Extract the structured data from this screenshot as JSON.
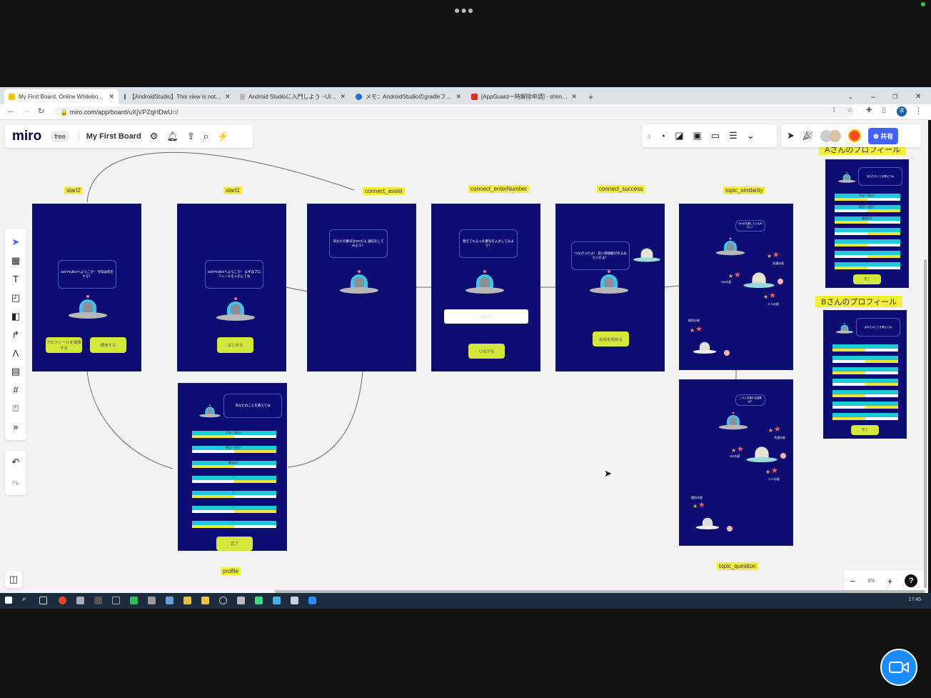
{
  "browser": {
    "tabs": [
      {
        "title": "My First Board, Online Whitebo…",
        "color": "#f5c400"
      },
      {
        "title": "【AndroidStudio】This view is not…",
        "color": "#555"
      },
      {
        "title": "Android Studioに入門しよう ~UI…",
        "color": "#888"
      },
      {
        "title": "メモ：AndroidStudioのgradleフ…",
        "color": "#1e6fd9"
      },
      {
        "title": "[AppGuard一時解除申請] - shim…",
        "color": "#d93025"
      }
    ],
    "new_tab": "+",
    "url": "miro.com/app/board/uXjVPZqHDwU=/",
    "profile_initial": "求"
  },
  "miro": {
    "logo": "miro",
    "plan": "free",
    "board_name": "My First Board",
    "share_label": "共有",
    "zoom_level": "9%",
    "help": "?",
    "accent": "#4262ff"
  },
  "frames": [
    {
      "label": "start2",
      "bubble": "Self Profilerへようこそ！ 今日は何をする？",
      "buttons": [
        "プロフィールを編集する",
        "通信する"
      ]
    },
    {
      "label": "start1",
      "bubble": "Self Profilerへようこそ！ まずはプロフィールを入力してね",
      "buttons": [
        "はじめる"
      ]
    },
    {
      "label": "connect_assist",
      "bubble": "あなたの番号はOOだよ 通信をしてみよう！"
    },
    {
      "label": "connect_enterNumber",
      "bubble": "教えてもらった番号を入力してみよう！",
      "input_placeholder": "入力する",
      "buttons": [
        "つながる"
      ]
    },
    {
      "label": "connect_success",
      "bubble": "つながったよ！ 近い価値観があるみたいだよ！",
      "buttons": [
        "会話を始める"
      ]
    },
    {
      "label": "topic_similarity",
      "bubble": "OOが共通しているみたい！",
      "tags": [
        "OOの星",
        "共通の星",
        "二人の星",
        "個別の星"
      ]
    },
    {
      "label": "profile",
      "bubble": "あなたのことを教えてね",
      "bars": [
        "犬派？猫派？",
        "朝型？夜型？",
        "趣味は？",
        "？",
        "？",
        "？",
        "？"
      ],
      "buttons": [
        "完了"
      ]
    },
    {
      "label": "topic_question",
      "bubble": "二人に共通する話題は？",
      "tags": [
        "OOの星",
        "共通の星",
        "二人の星",
        "個別の星"
      ]
    },
    {
      "label": "Aさんのプロフィール",
      "bubble": "あなたのことを教えてね",
      "bars": [
        "犬派？猫派？",
        "朝型？夜型？",
        "趣味は？",
        "",
        "",
        "",
        ""
      ],
      "buttons": [
        "完了"
      ]
    },
    {
      "label": "Bさんのプロフィール",
      "bubble": "あなたのことを教えてね",
      "bars": [
        "",
        "",
        "",
        "",
        "",
        "",
        ""
      ],
      "buttons": [
        "完了"
      ]
    }
  ],
  "taskbar": {
    "clock": "17:45"
  },
  "colors": {
    "frame_bg": "#0c0c72",
    "button": "#d3e83b",
    "bar": "#1ecad3",
    "label": "#f5ef3a"
  }
}
